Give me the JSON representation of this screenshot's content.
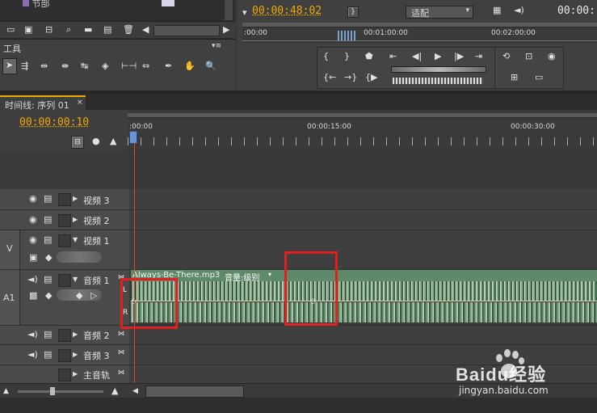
{
  "topleft": {
    "menu_item": "节部"
  },
  "tools": {
    "title": "工具"
  },
  "monitor": {
    "timecode": "00:00:48:02",
    "fit": "适配",
    "timecode_right": "00:00:",
    "ruler": [
      ":00:00",
      "00:01:00:00",
      "00:02:00:00"
    ]
  },
  "timeline": {
    "tab": "时间线: 序列 01",
    "timecode": "00:00:00:10",
    "ruler": [
      ":00:00",
      "00:00:15:00",
      "00:00:30:00"
    ]
  },
  "tracks": [
    {
      "name": "视频 3",
      "kind": "video"
    },
    {
      "name": "视频 2",
      "kind": "video"
    },
    {
      "name": "视频 1",
      "kind": "video",
      "label": "V"
    },
    {
      "name": "音频 1",
      "kind": "audio",
      "label": "A1"
    },
    {
      "name": "音频 2",
      "kind": "audio"
    },
    {
      "name": "音频 3",
      "kind": "audio"
    },
    {
      "name": "主音轨",
      "kind": "master"
    }
  ],
  "clip": {
    "name": "Always-Be-There.mp3",
    "param": "音量:级别",
    "channels": [
      "L",
      "R"
    ]
  },
  "watermark": {
    "brand": "Baidu经验",
    "url": "jingyan.baidu.com"
  },
  "colors": {
    "accent": "#f0a800",
    "highlight": "#e02020",
    "audio_clip": "#c8dcb8",
    "clip_header": "#5f8a6a"
  }
}
